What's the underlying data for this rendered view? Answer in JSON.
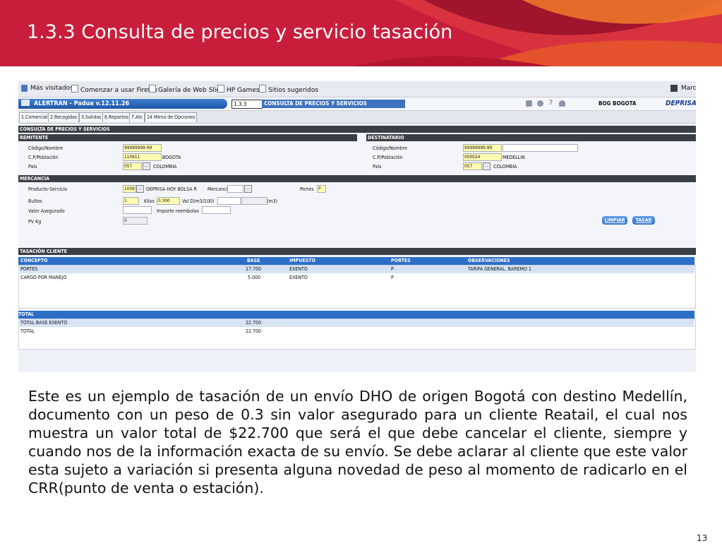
{
  "slide": {
    "title": "1.3.3 Consulta de precios y servicio tasación",
    "page_number": "13",
    "body": "Este es un ejemplo de tasación de un envío DHO de origen Bogotá con destino Medellín, documento con un peso de 0.3 sin valor asegurado para un cliente Reatail, el cual nos muestra un valor total de $22.700 que será el que debe cancelar el cliente, siempre y cuando nos de la información exacta de su envío. Se debe aclarar al cliente que este valor esta sujeto a variación si presenta alguna novedad de peso al momento de radicarlo en el CRR(punto de venta o estación)."
  },
  "colors": {
    "banner": "#c81e3c",
    "banner_accent": "#f07a2a",
    "app_blue": "#2d6ec9",
    "section_bar": "#3a3e46"
  },
  "favorites": {
    "items": [
      "Más visitados",
      "Comenzar a usar Firefox",
      "Galería de Web Slice",
      "HP Games",
      "Sitios sugeridos"
    ],
    "right_label": "Marc"
  },
  "app": {
    "title": "ALERTRAN - Padua  v.12.11.26",
    "code": "1.3.3",
    "screen": "CONSULTA DE PRECIOS Y SERVICIOS",
    "city": "BOG BOGOTA",
    "logo": "DEPRISA",
    "tabs": [
      "1.Comercial",
      "2.Recogidas",
      "3.Salidas",
      "6.Repartos",
      "7.Atc",
      "14 Menú de Opciones"
    ]
  },
  "form": {
    "section_title": "CONSULTA DE PRECIOS Y SERVICIOS",
    "remitente": {
      "header": "REMITENTE",
      "codigo_label": "Código/Nombre",
      "codigo": "99999999-99",
      "cp_label": "C.P/Población",
      "cp": "110911",
      "poblacion": "BOGOTA",
      "pais_label": "País",
      "pais_code": "057",
      "pais": "COLOMBIA"
    },
    "destinatario": {
      "header": "DESTINATARIO",
      "codigo_label": "Código/Nombre",
      "codigo": "99999999-99",
      "cp_label": "C.P/Población",
      "cp": "050024",
      "poblacion": "MEDELLIN",
      "pais_label": "País",
      "pais_code": "057",
      "pais": "COLOMBIA"
    },
    "mercancia": {
      "header": "MERCANCÍA",
      "producto_label": "Producto-Servicio",
      "producto_code": "1009",
      "producto": "DEPRISA HOY BOLSA R",
      "mercancia_label": "Mercancía",
      "portes_label": "Portes",
      "portes": "P",
      "bultos_label": "Bultos",
      "bultos": "1",
      "kilos_label": "Kilos",
      "kilos": "0.300",
      "vol_label": "Vol D(m3/100)",
      "m3_label": "(m3)",
      "valor_label": "Valor Asegurado",
      "importe_label": "Importe reembolso",
      "pv_label": "PV Kg",
      "pv": "0"
    },
    "buttons": {
      "limpiar": "LIMPIAR",
      "tasar": "TASAR"
    }
  },
  "tasacion": {
    "header": "TASACIÓN CLIENTE",
    "columns": [
      "CONCEPTO",
      "BASE",
      "IMPUESTO",
      "PORTES",
      "OBSERVACIONES"
    ],
    "rows": [
      [
        "PORTES",
        "17.700",
        "EXENTO",
        "P",
        "TARIFA GENERAL. BAREMO 1"
      ],
      [
        "CARGO POR MANEJO",
        "5.000",
        "EXENTO",
        "P",
        ""
      ]
    ]
  },
  "total": {
    "header": "TOTAL",
    "rows": [
      [
        "TOTAL BASE EXENTO",
        "22.700"
      ],
      [
        "TOTAL",
        "22.700"
      ]
    ]
  }
}
